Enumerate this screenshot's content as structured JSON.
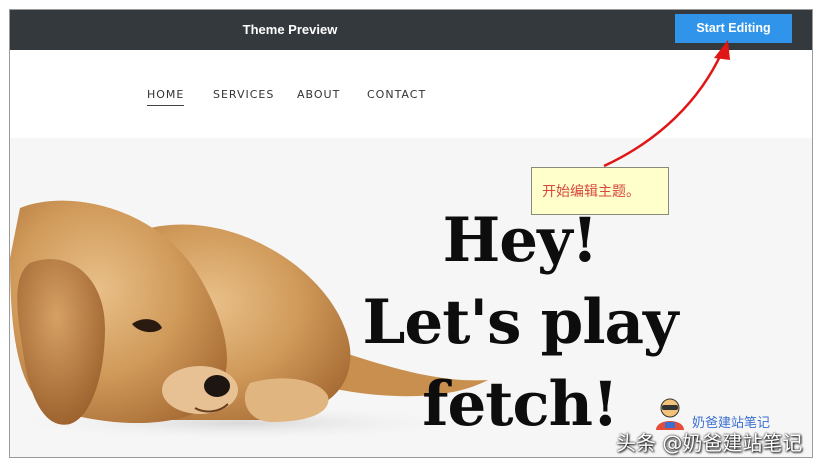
{
  "topbar": {
    "title": "Theme Preview",
    "start_editing_label": "Start Editing"
  },
  "nav": {
    "items": [
      {
        "label": "HOME",
        "active": true
      },
      {
        "label": "SERVICES"
      },
      {
        "label": "ABOUT"
      },
      {
        "label": "CONTACT"
      }
    ]
  },
  "hero": {
    "line1": "Hey!",
    "line2": "Let's play",
    "line3": "fetch!"
  },
  "annotation": {
    "text": "开始编辑主题。",
    "color": "#d8483d",
    "arrow_color": "#e01515"
  },
  "watermark": {
    "small": "奶爸建站笔记",
    "big": "头条 @奶爸建站笔记"
  },
  "colors": {
    "topbar": "#34393d",
    "accent": "#2f94ea",
    "hero_bg": "#f6f6f7"
  }
}
